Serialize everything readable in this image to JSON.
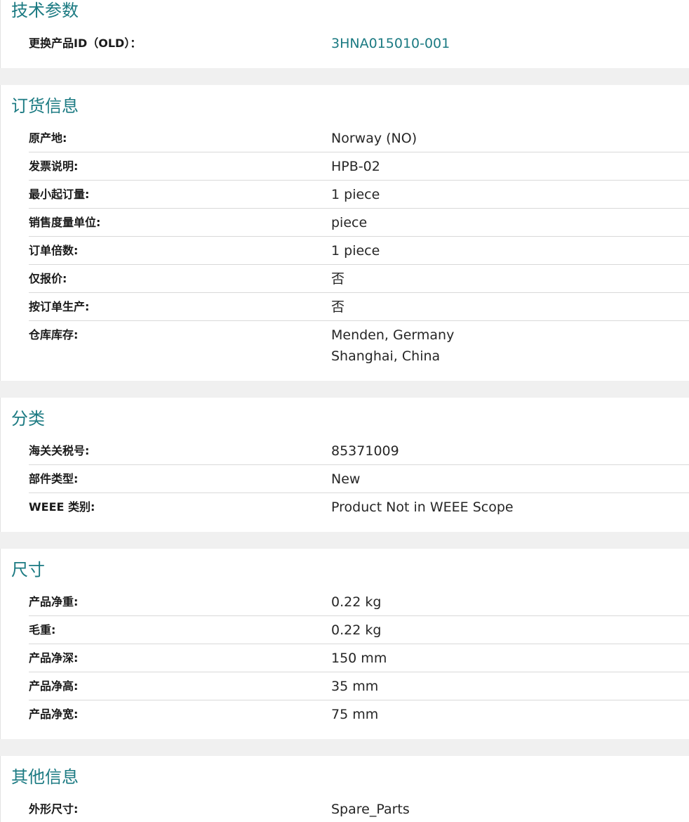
{
  "sections": {
    "tech": {
      "title": "技术参数",
      "rows": [
        {
          "label": "更换产品ID（OLD）：",
          "value": "3HNA015010-001"
        }
      ]
    },
    "order": {
      "title": "订货信息",
      "rows": [
        {
          "label": "原产地:",
          "value": "Norway (NO)"
        },
        {
          "label": "发票说明:",
          "value": "HPB-02"
        },
        {
          "label": "最小起订量:",
          "value": "1 piece"
        },
        {
          "label": "销售度量单位:",
          "value": "piece"
        },
        {
          "label": "订单倍数:",
          "value": "1 piece"
        },
        {
          "label": "仅报价:",
          "value": "否"
        },
        {
          "label": "按订单生产:",
          "value": "否"
        },
        {
          "label": "仓库库存:",
          "value": [
            "Menden, Germany",
            "Shanghai, China"
          ]
        }
      ]
    },
    "classification": {
      "title": "分类",
      "rows": [
        {
          "label": "海关关税号:",
          "value": "85371009"
        },
        {
          "label": "部件类型:",
          "value": "New"
        },
        {
          "label": "WEEE 类别:",
          "value": "Product Not in WEEE Scope"
        }
      ]
    },
    "dimensions": {
      "title": "尺寸",
      "rows": [
        {
          "label": "产品净重:",
          "value": "0.22 kg"
        },
        {
          "label": "毛重:",
          "value": "0.22 kg"
        },
        {
          "label": "产品净深:",
          "value": "150 mm"
        },
        {
          "label": "产品净高:",
          "value": "35 mm"
        },
        {
          "label": "产品净宽:",
          "value": "75 mm"
        }
      ]
    },
    "other": {
      "title": "其他信息",
      "rows": [
        {
          "label": "外形尺寸:",
          "value": "Spare_Parts"
        }
      ]
    }
  },
  "colors": {
    "accent": "#1b7a82",
    "separator": "#d9d9d9",
    "gap": "#f0f0f0"
  }
}
